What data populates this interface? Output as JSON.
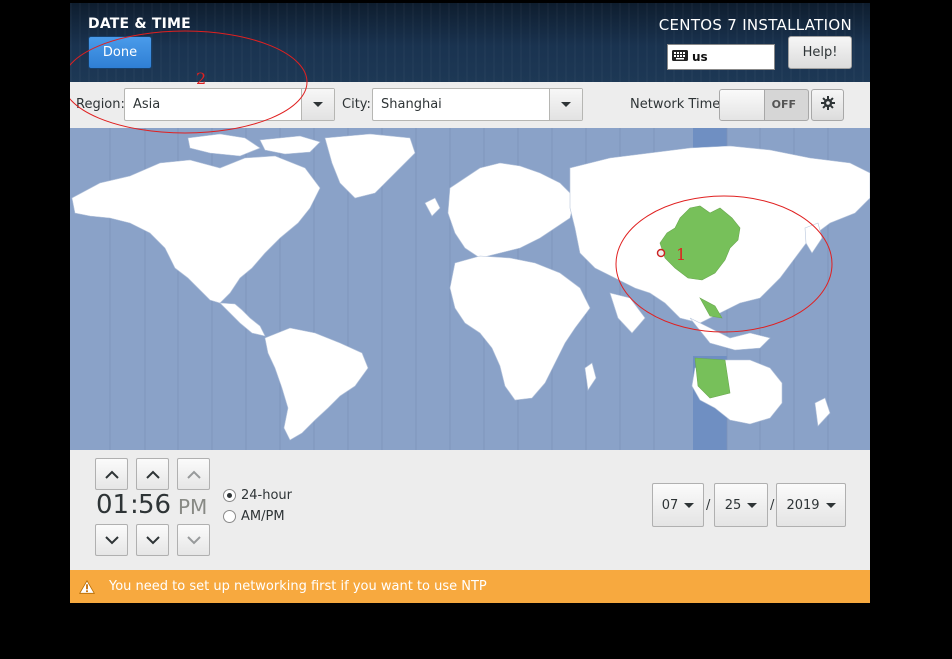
{
  "header": {
    "spoke_title": "DATE & TIME",
    "done_label": "Done",
    "product_title": "CENTOS 7 INSTALLATION",
    "keyboard_layout": "us",
    "help_label": "Help!"
  },
  "location": {
    "region_label": "Region:",
    "region_value": "Asia",
    "city_label": "City:",
    "city_value": "Shanghai",
    "network_time_label": "Network Time",
    "network_time_state": "OFF"
  },
  "time": {
    "hours": "01",
    "minutes": "56",
    "separator": ":",
    "ampm": "PM",
    "format_24_label": "24-hour",
    "format_ampm_label": "AM/PM",
    "selected_format": "24-hour"
  },
  "date": {
    "month": "07",
    "day": "25",
    "year": "2019",
    "separator": "/"
  },
  "warning": {
    "text": "You need to set up networking first if you want to use NTP"
  },
  "annotations": {
    "marker_1": "1",
    "marker_2": "2"
  },
  "colors": {
    "ocean": "#8aa2c8",
    "land": "#ffffff",
    "selected_zone_land": "#77c05a",
    "selected_zone_band": "#6f8fc2",
    "warning": "#f7a93f",
    "accent": "#3584e4",
    "annotation": "#e02020"
  },
  "icons": {
    "keyboard": "keyboard-icon",
    "gear": "gear-icon",
    "warning": "warning-icon",
    "location_pin": "map-pin-icon"
  }
}
